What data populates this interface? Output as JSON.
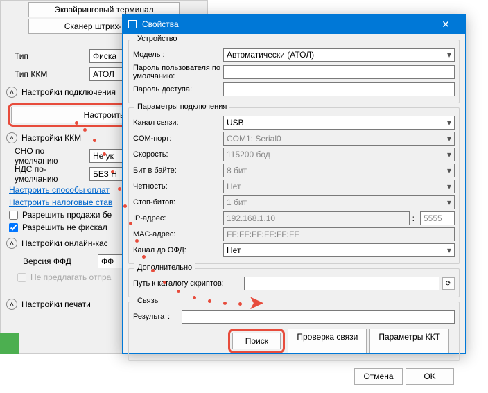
{
  "bg": {
    "acq_terminal": "Эквайринговый терминал",
    "barcode_scanner": "Сканер штрих-кодов",
    "type_label": "Тип",
    "type_value": "Фиска",
    "kkm_type_label": "Тип ККМ",
    "kkm_type_value": "АТОЛ",
    "conn_settings": "Настройки подключения",
    "configure": "Настроить",
    "kkm_settings": "Настройки ККМ",
    "sno_label": "СНО по умолчанию",
    "sno_value": "Не ук",
    "nds_label": "НДС по-умолчанию",
    "nds_value": "БЕЗ Н",
    "payment_methods": "Настроить способы оплат",
    "tax_rates": "Настроить налоговые став",
    "allow_sales": "Разрешить продажи бе",
    "allow_nonfiscal": "Разрешить не фискал",
    "online_kass": "Настройки онлайн-кас",
    "ffd_label": "Версия ФФД",
    "ffd_value": "ФФ",
    "no_suggest": "Не предлагать отпра",
    "print_settings": "Настройки печати"
  },
  "dialog": {
    "title": "Свойства",
    "device": {
      "section": "Устройство",
      "model_label": "Модель :",
      "model_value": "Автоматически (АТОЛ)",
      "user_pwd_label": "Пароль пользователя по умолчанию:",
      "access_pwd_label": "Пароль доступа:"
    },
    "conn": {
      "section": "Параметры подключения",
      "channel_label": "Канал связи:",
      "channel_value": "USB",
      "com_label": "COM-порт:",
      "com_value": "COM1: Serial0",
      "speed_label": "Скорость:",
      "speed_value": "115200 бод",
      "bits_label": "Бит в байте:",
      "bits_value": "8 бит",
      "parity_label": "Четность:",
      "parity_value": "Нет",
      "stop_label": "Стоп-битов:",
      "stop_value": "1 бит",
      "ip_label": "IP-адрес:",
      "ip_value": "192.168.1.10",
      "port_value": "5555",
      "mac_label": "MAC-адрес:",
      "mac_value": "FF:FF:FF:FF:FF:FF",
      "ofd_label": "Канал до ОФД:",
      "ofd_value": "Нет"
    },
    "extra": {
      "section": "Дополнительно",
      "scripts_label": "Путь к каталогу скриптов:"
    },
    "link": {
      "section": "Связь",
      "result_label": "Результат:",
      "search": "Поиск",
      "check": "Проверка связи",
      "kkt_params": "Параметры ККТ"
    },
    "cancel": "Отмена",
    "ok": "OK"
  }
}
